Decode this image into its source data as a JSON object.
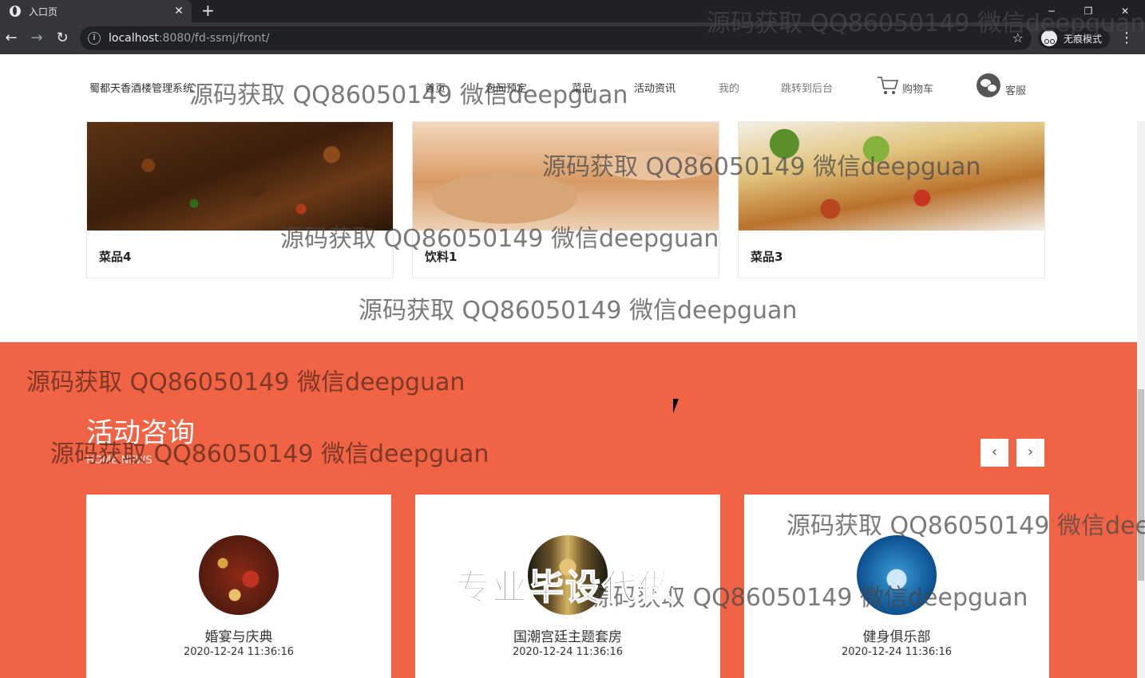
{
  "browser": {
    "tab_title": "入口页",
    "tab_close": "✕",
    "new_tab": "+",
    "window_minimize": "─",
    "window_restore": "❐",
    "window_close": "✕",
    "url_host": "localhost",
    "url_path": ":8080/fd-ssmj/front/",
    "incognito_label": "无痕模式",
    "menu_dots": "⋮",
    "back": "←",
    "forward": "→",
    "reload": "↻",
    "bookmark_star": "☆"
  },
  "header": {
    "brand": "蜀都天香酒楼管理系统",
    "nav": [
      "首页",
      "包间预定",
      "菜品",
      "活动资讯",
      "我的",
      "跳转到后台"
    ],
    "cart_label": "购物车",
    "service_label": "客服"
  },
  "dishes": [
    {
      "name": "菜品4"
    },
    {
      "name": "饮料1"
    },
    {
      "name": "菜品3"
    }
  ],
  "news": {
    "title": "活动咨询",
    "subtitle": "HOME NEWS",
    "prev": "‹",
    "next": "›",
    "items": [
      {
        "name": "婚宴与庆典",
        "date": "2020-12-24 11:36:16"
      },
      {
        "name": "国潮宫廷主题套房",
        "date": "2020-12-24 11:36:16"
      },
      {
        "name": "健身俱乐部",
        "date": "2020-12-24 11:36:16"
      }
    ]
  },
  "overlays": {
    "watermark": "源码获取 QQ86050149 微信deepguan",
    "watermark_cut": "源码获取 QQ86050149 微信dee",
    "promo": "专业毕设代做"
  },
  "colors": {
    "news_background": "#f06445",
    "browser_dark": "#202124",
    "browser_toolbar": "#35363a"
  }
}
